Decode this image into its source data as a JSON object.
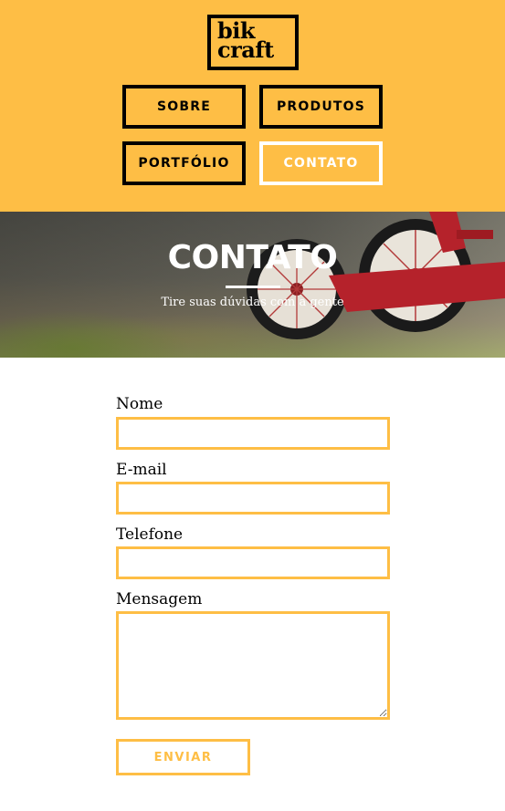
{
  "brand": {
    "logo_line1": "bik",
    "logo_line2": "craft",
    "color": "#FEBE45"
  },
  "nav": {
    "items": [
      {
        "label": "SOBRE",
        "active": false
      },
      {
        "label": "PRODUTOS",
        "active": false
      },
      {
        "label": "PORTFÓLIO",
        "active": false
      },
      {
        "label": "CONTATO",
        "active": true
      }
    ]
  },
  "hero": {
    "title": "CONTATO",
    "subtitle": "Tire suas dúvidas com a gente"
  },
  "form": {
    "fields": [
      {
        "label": "Nome",
        "value": ""
      },
      {
        "label": "E-mail",
        "value": ""
      },
      {
        "label": "Telefone",
        "value": ""
      },
      {
        "label": "Mensagem",
        "value": ""
      }
    ],
    "submit_label": "ENVIAR"
  }
}
